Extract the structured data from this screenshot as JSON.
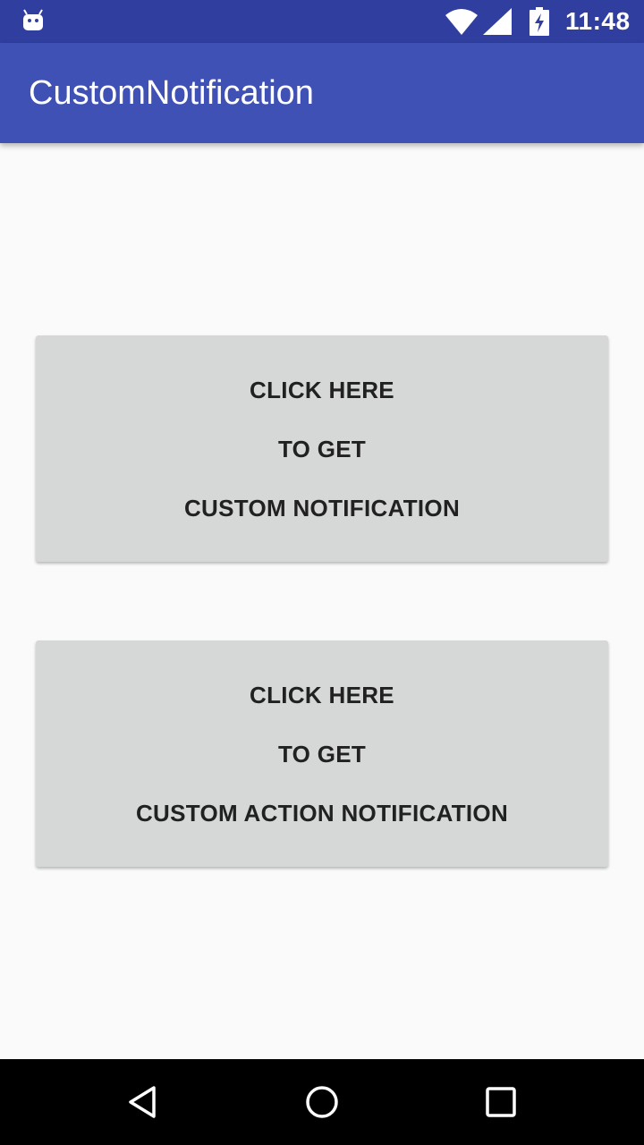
{
  "status_bar": {
    "time": "11:48",
    "icons": [
      "android-debug-icon",
      "wifi-icon",
      "cell-signal-icon",
      "battery-charging-icon"
    ]
  },
  "app_bar": {
    "title": "CustomNotification",
    "color": "#3f51b5",
    "status_color": "#303f9f"
  },
  "buttons": [
    {
      "lines": [
        "CLICK HERE",
        "TO GET",
        "CUSTOM NOTIFICATION"
      ]
    },
    {
      "lines": [
        "CLICK HERE",
        "TO GET",
        "CUSTOM ACTION NOTIFICATION"
      ]
    }
  ],
  "nav_bar": {
    "icons": [
      "back-icon",
      "home-icon",
      "recents-icon"
    ]
  },
  "colors": {
    "background": "#fafafa",
    "button_bg": "#d6d7d7",
    "button_text": "#212121"
  }
}
